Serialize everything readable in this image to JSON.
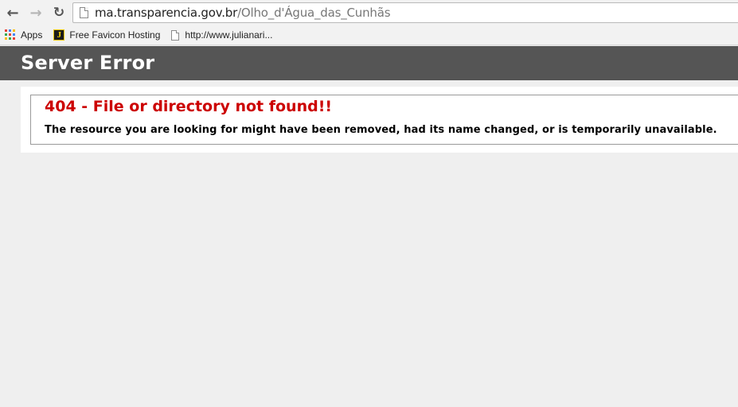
{
  "browser": {
    "url_domain": "ma.transparencia.gov.br",
    "url_path": "/Olho_d'Água_das_Cunhãs",
    "nav": {
      "back_icon": "arrow-left-icon",
      "forward_icon": "arrow-right-icon",
      "reload_icon": "reload-icon"
    },
    "bookmarks": [
      {
        "label": "Apps",
        "icon": "apps-grid-icon"
      },
      {
        "label": "Free Favicon Hosting",
        "icon": "j-favicon-icon"
      },
      {
        "label": "http://www.julianari...",
        "icon": "page-icon"
      }
    ]
  },
  "page": {
    "header_title": "Server Error",
    "error_title": "404 - File or directory not found!!",
    "error_message": "The resource you are looking for might have been removed, had its name changed, or is temporarily unavailable.",
    "colors": {
      "header_bg": "#555555",
      "error_red": "#cc0000",
      "page_bg": "#efefef"
    }
  }
}
